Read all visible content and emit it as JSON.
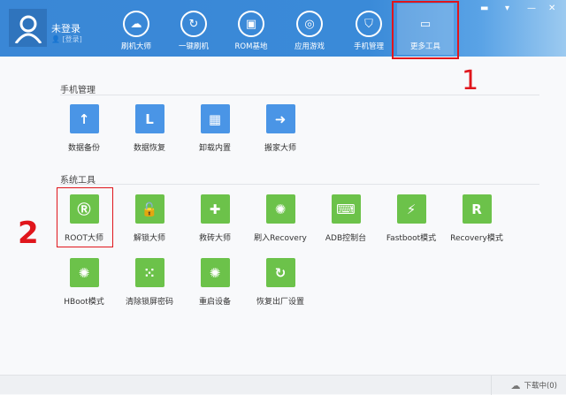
{
  "user": {
    "name": "未登录",
    "login_link": "[登录]"
  },
  "nav": [
    {
      "label": "刷机大师",
      "icon": "cloud-icon"
    },
    {
      "label": "一键刷机",
      "icon": "refresh-icon"
    },
    {
      "label": "ROM基地",
      "icon": "android-icon"
    },
    {
      "label": "应用游戏",
      "icon": "gamepad-icon"
    },
    {
      "label": "手机管理",
      "icon": "shield-icon"
    },
    {
      "label": "更多工具",
      "icon": "toolbox-icon",
      "active": true
    }
  ],
  "window_controls": [
    "feedback-icon",
    "menu-icon",
    "minimize-icon",
    "close-icon"
  ],
  "sections": [
    {
      "title": "手机管理",
      "items": [
        {
          "label": "数据备份",
          "glyph": "↑"
        },
        {
          "label": "数据恢复",
          "glyph": "L"
        },
        {
          "label": "卸载内置",
          "glyph": "▦"
        },
        {
          "label": "搬家大师",
          "glyph": "➜"
        }
      ]
    },
    {
      "title": "系统工具",
      "items": [
        {
          "label": "ROOT大师",
          "glyph": "Ⓡ"
        },
        {
          "label": "解锁大师",
          "glyph": "🔓"
        },
        {
          "label": "救砖大师",
          "glyph": "✚"
        },
        {
          "label": "刷入Recovery",
          "glyph": "✺"
        },
        {
          "label": "ADB控制台",
          "glyph": "⌨"
        },
        {
          "label": "Fastboot模式",
          "glyph": "⚡"
        },
        {
          "label": "Recovery模式",
          "glyph": "R"
        },
        {
          "label": "HBoot模式",
          "glyph": "✺"
        },
        {
          "label": "清除锁屏密码",
          "glyph": "⁙"
        },
        {
          "label": "重启设备",
          "glyph": "✺"
        },
        {
          "label": "恢复出厂设置",
          "glyph": "↻"
        }
      ]
    }
  ],
  "annotations": {
    "one": "1",
    "two": "2"
  },
  "footer": {
    "download_status": "下载中(0)"
  },
  "colors": {
    "header": "#3a87d6",
    "highlight": "#e0161c",
    "blue_tile": "#4a95e6",
    "green_tile": "#6cc24a"
  }
}
